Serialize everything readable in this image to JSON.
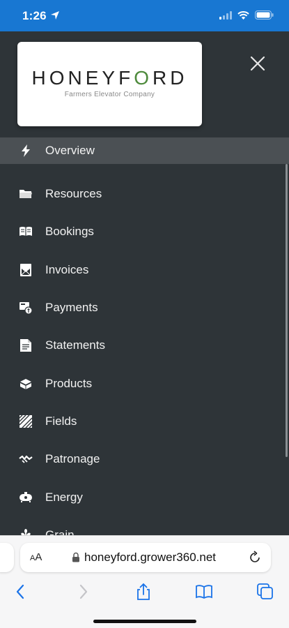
{
  "status_bar": {
    "time": "1:26"
  },
  "logo": {
    "wordmark_left": "HONEYF",
    "wordmark_mark": "O",
    "wordmark_right": "RD",
    "subtitle": "Farmers Elevator Company"
  },
  "menu": {
    "items": [
      {
        "label": "Overview",
        "icon": "bolt-icon",
        "active": true
      },
      {
        "label": "Resources",
        "icon": "folder-icon"
      },
      {
        "label": "Bookings",
        "icon": "book-icon"
      },
      {
        "label": "Invoices",
        "icon": "envelope-icon"
      },
      {
        "label": "Payments",
        "icon": "payment-icon"
      },
      {
        "label": "Statements",
        "icon": "document-icon"
      },
      {
        "label": "Products",
        "icon": "boxes-icon"
      },
      {
        "label": "Fields",
        "icon": "field-icon"
      },
      {
        "label": "Patronage",
        "icon": "handshake-icon"
      },
      {
        "label": "Energy",
        "icon": "tank-icon"
      },
      {
        "label": "Grain",
        "icon": "wheat-icon"
      }
    ]
  },
  "browser": {
    "aa_label_small": "A",
    "aa_label_large": "A",
    "url": "honeyford.grower360.net"
  },
  "colors": {
    "status_bar": "#1877d2",
    "drawer_bg": "#2e3438",
    "active_row": "#4b5054",
    "ios_blue": "#1a73e8"
  }
}
